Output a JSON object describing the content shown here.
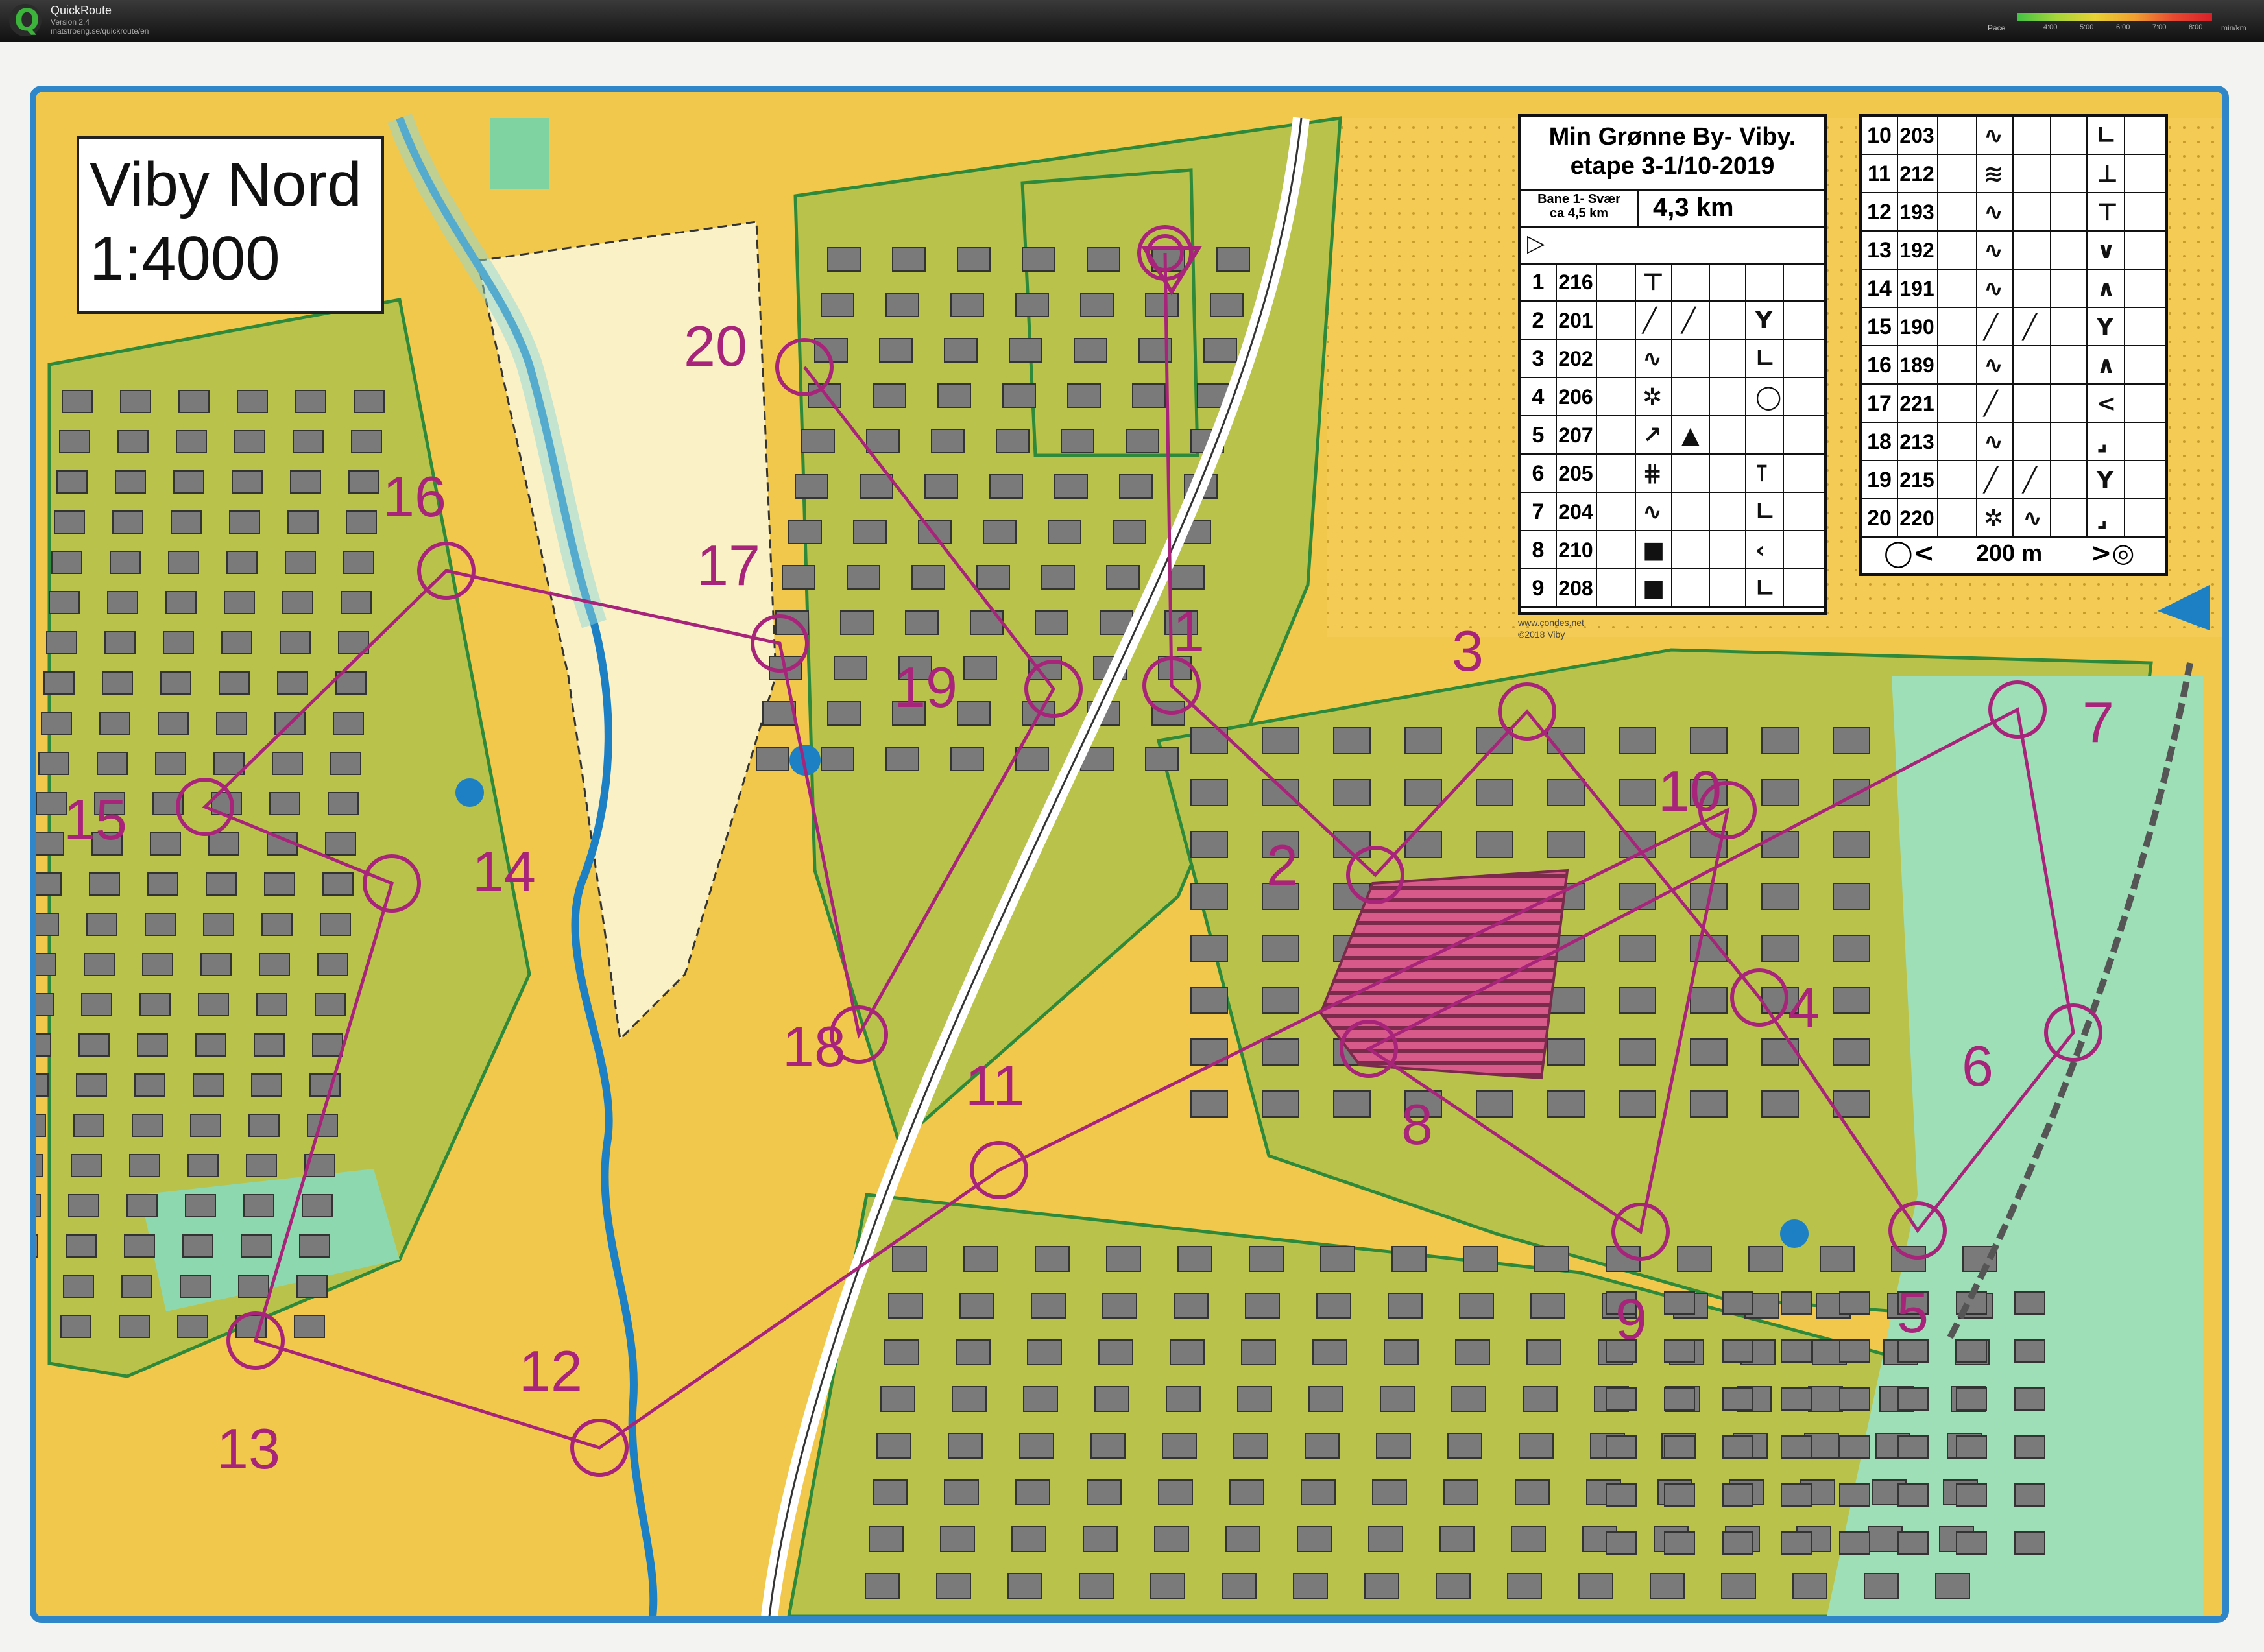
{
  "app": {
    "name": "QuickRoute",
    "version": "Version 2.4",
    "url": "matstroeng.se/quickroute/en",
    "pace_label": "Pace",
    "pace_ticks": [
      "4:00",
      "5:00",
      "6:00",
      "7:00",
      "8:00"
    ],
    "pace_unit": "min/km"
  },
  "map": {
    "title": "Viby Nord",
    "scale": "1:4000",
    "credit_line1": "www.condes.net",
    "credit_line2": "©2018 Viby",
    "colors": {
      "frame": "#2f86c8",
      "course": "#a8247a",
      "open_land": "#f2c84c",
      "forest": "#b8c44a",
      "water": "#1d7fc4",
      "building": "#7a7a7a"
    }
  },
  "control_description": {
    "event_title": "Min Grønne By- Viby.",
    "event_stage": "etape 3-1/10-2019",
    "course_name_line1": "Bane 1- Svær",
    "course_name_line2": "ca 4,5 km",
    "course_length": "4,3 km",
    "start_symbol": "▷",
    "rows_left": [
      {
        "num": "1",
        "code": "216",
        "sym1": "⊤",
        "sym2": "",
        "sym3": ""
      },
      {
        "num": "2",
        "code": "201",
        "sym1": "╱",
        "sym2": "╱",
        "sym3": "Y"
      },
      {
        "num": "3",
        "code": "202",
        "sym1": "∿",
        "sym2": "",
        "sym3": "∟"
      },
      {
        "num": "4",
        "code": "206",
        "sym1": "✲",
        "sym2": "",
        "sym3": "◯"
      },
      {
        "num": "5",
        "code": "207",
        "sym1": "↗",
        "sym2": "▲",
        "sym3": ""
      },
      {
        "num": "6",
        "code": "205",
        "sym1": "⋕",
        "sym2": "",
        "sym3": "⊺"
      },
      {
        "num": "7",
        "code": "204",
        "sym1": "∿",
        "sym2": "",
        "sym3": "∟"
      },
      {
        "num": "8",
        "code": "210",
        "sym1": "■",
        "sym2": "",
        "sym3": "‹"
      },
      {
        "num": "9",
        "code": "208",
        "sym1": "■",
        "sym2": "",
        "sym3": "∟"
      }
    ],
    "rows_right": [
      {
        "num": "10",
        "code": "203",
        "sym1": "∿",
        "sym2": "",
        "sym3": "∟"
      },
      {
        "num": "11",
        "code": "212",
        "sym1": "≋",
        "sym2": "",
        "sym3": "⊥"
      },
      {
        "num": "12",
        "code": "193",
        "sym1": "∿",
        "sym2": "",
        "sym3": "⊤"
      },
      {
        "num": "13",
        "code": "192",
        "sym1": "∿",
        "sym2": "",
        "sym3": "∨"
      },
      {
        "num": "14",
        "code": "191",
        "sym1": "∿",
        "sym2": "",
        "sym3": "∧"
      },
      {
        "num": "15",
        "code": "190",
        "sym1": "╱",
        "sym2": "╱",
        "sym3": "Y"
      },
      {
        "num": "16",
        "code": "189",
        "sym1": "∿",
        "sym2": "",
        "sym3": "∧"
      },
      {
        "num": "17",
        "code": "221",
        "sym1": "╱",
        "sym2": "",
        "sym3": "<"
      },
      {
        "num": "18",
        "code": "213",
        "sym1": "∿",
        "sym2": "",
        "sym3": "⌟"
      },
      {
        "num": "19",
        "code": "215",
        "sym1": "╱",
        "sym2": "╱",
        "sym3": "Y"
      },
      {
        "num": "20",
        "code": "220",
        "sym1": "✲",
        "sym2": "∿",
        "sym3": "⌟"
      }
    ],
    "finish_left": "◯<",
    "finish_distance": "200 m",
    "finish_right": ">◎"
  },
  "controls": [
    {
      "label": "1"
    },
    {
      "label": "2"
    },
    {
      "label": "3"
    },
    {
      "label": "4"
    },
    {
      "label": "5"
    },
    {
      "label": "6"
    },
    {
      "label": "7"
    },
    {
      "label": "8"
    },
    {
      "label": "9"
    },
    {
      "label": "10"
    },
    {
      "label": "11"
    },
    {
      "label": "12"
    },
    {
      "label": "13"
    },
    {
      "label": "14"
    },
    {
      "label": "15"
    },
    {
      "label": "16"
    },
    {
      "label": "17"
    },
    {
      "label": "18"
    },
    {
      "label": "19"
    },
    {
      "label": "20"
    }
  ]
}
